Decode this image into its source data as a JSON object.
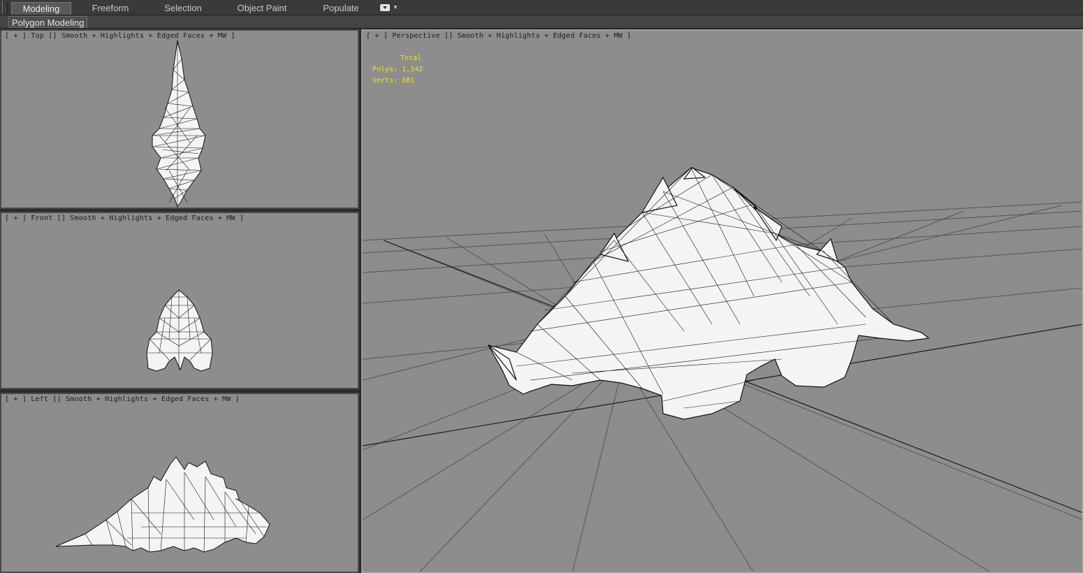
{
  "tabs": [
    {
      "label": "Modeling",
      "active": true
    },
    {
      "label": "Freeform",
      "active": false
    },
    {
      "label": "Selection",
      "active": false
    },
    {
      "label": "Object Paint",
      "active": false
    },
    {
      "label": "Populate",
      "active": false
    }
  ],
  "ribbon_panel": {
    "label": "Polygon Modeling"
  },
  "viewports": {
    "top": {
      "label": "[ + ] Top [] Smooth + Highlights + Edged Faces + MW ]"
    },
    "front": {
      "label": "[ + ] Front [] Smooth + Highlights + Edged Faces + MW ]"
    },
    "left": {
      "label": "[ + ] Left [] Smooth + Highlights + Edged Faces + MW ]"
    },
    "perspective": {
      "label": "[ + ] Perspective [] Smooth + Highlights + Edged Faces + MW ]"
    }
  },
  "stats": {
    "header": "Total",
    "polys_label": "Polys:",
    "polys_value": "1,342",
    "verts_label": "Verts:",
    "verts_value": "881"
  },
  "colors": {
    "viewport_bg": "#8d8d8d",
    "stats_text": "#f0e41a",
    "mesh_fill": "#f4f4f4",
    "mesh_edges": "#111111"
  },
  "icons": {
    "ribbon_options": "dropdown-icon"
  }
}
